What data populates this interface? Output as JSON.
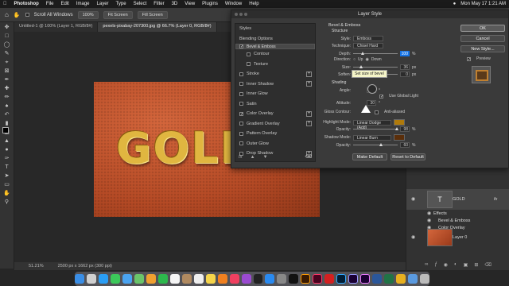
{
  "menubar": {
    "app": "Photoshop",
    "items": [
      "File",
      "Edit",
      "Image",
      "Layer",
      "Type",
      "Select",
      "Filter",
      "3D",
      "View",
      "Plugins",
      "Window",
      "Help"
    ],
    "clock": "Mon May 17  1:21 AM"
  },
  "options_bar": {
    "scroll_all": "Scroll All Windows",
    "zoom": "100%",
    "fit": "Fit Screen",
    "fill": "Fill Screen"
  },
  "tabs": [
    {
      "label": "Untitled-1 @ 100% (Layer 1, RGB/8#)"
    },
    {
      "label": "pexels-pixabay-207300.jpg @ 66.7% (Layer 0, RGB/8#)"
    }
  ],
  "canvas": {
    "text": "GOLD"
  },
  "status": {
    "zoom": "51.21%",
    "size": "2500 px x 1662 px (300 ppi)"
  },
  "dialog": {
    "title": "Layer Style",
    "styles_header": "Styles",
    "blending_options": "Blending Options",
    "style_items": [
      {
        "label": "Bevel & Emboss",
        "checked": true,
        "selected": true,
        "sub": false,
        "plus": false
      },
      {
        "label": "Contour",
        "checked": false,
        "selected": false,
        "sub": true,
        "plus": false
      },
      {
        "label": "Texture",
        "checked": false,
        "selected": false,
        "sub": true,
        "plus": false
      },
      {
        "label": "Stroke",
        "checked": false,
        "selected": false,
        "sub": false,
        "plus": true
      },
      {
        "label": "Inner Shadow",
        "checked": false,
        "selected": false,
        "sub": false,
        "plus": true
      },
      {
        "label": "Inner Glow",
        "checked": false,
        "selected": false,
        "sub": false,
        "plus": false
      },
      {
        "label": "Satin",
        "checked": false,
        "selected": false,
        "sub": false,
        "plus": false
      },
      {
        "label": "Color Overlay",
        "checked": true,
        "selected": false,
        "sub": false,
        "plus": true
      },
      {
        "label": "Gradient Overlay",
        "checked": false,
        "selected": false,
        "sub": false,
        "plus": true
      },
      {
        "label": "Pattern Overlay",
        "checked": false,
        "selected": false,
        "sub": false,
        "plus": false
      },
      {
        "label": "Outer Glow",
        "checked": false,
        "selected": false,
        "sub": false,
        "plus": false
      },
      {
        "label": "Drop Shadow",
        "checked": false,
        "selected": false,
        "sub": false,
        "plus": true
      }
    ],
    "fx": "fx",
    "section_title": "Bevel & Emboss",
    "structure": "Structure",
    "shading": "Shading",
    "style_label": "Style:",
    "style_value": "Emboss",
    "technique_label": "Technique:",
    "technique_value": "Chisel Hard",
    "depth_label": "Depth:",
    "depth_value": "100",
    "depth_unit": "%",
    "direction_label": "Direction:",
    "dir_up": "Up",
    "dir_down": "Down",
    "size_label": "Size:",
    "size_value": "36",
    "size_unit": "px",
    "soften_label": "Soften:",
    "soften_value": "0",
    "soften_unit": "px",
    "tooltip": "Set size of bevel",
    "angle_label": "Angle:",
    "angle_value": "120",
    "angle_unit": "°",
    "global_light": "Use Global Light",
    "altitude_label": "Altitude:",
    "altitude_value": "30",
    "altitude_unit": "°",
    "gloss_label": "Gloss Contour:",
    "anti_aliased": "Anti-aliased",
    "highlight_label": "Highlight Mode:",
    "highlight_value": "Linear Dodge (Add)",
    "opacity1_label": "Opacity:",
    "opacity1_value": "98",
    "opacity1_unit": "%",
    "shadow_label": "Shadow Mode:",
    "shadow_value": "Linear Burn",
    "opacity2_label": "Opacity:",
    "opacity2_value": "60",
    "opacity2_unit": "%",
    "make_default": "Make Default",
    "reset_default": "Reset to Default",
    "ok": "OK",
    "cancel": "Cancel",
    "new_style": "New Style...",
    "preview": "Preview",
    "highlight_color": "#b07a0a",
    "shadow_color": "#5a2e0a"
  },
  "layers": [
    {
      "name": "GOLD",
      "fx": "fx"
    },
    {
      "name": "Effects"
    },
    {
      "name": "Bevel & Emboss"
    },
    {
      "name": "Color Overlay"
    },
    {
      "name": "Layer 0"
    }
  ]
}
